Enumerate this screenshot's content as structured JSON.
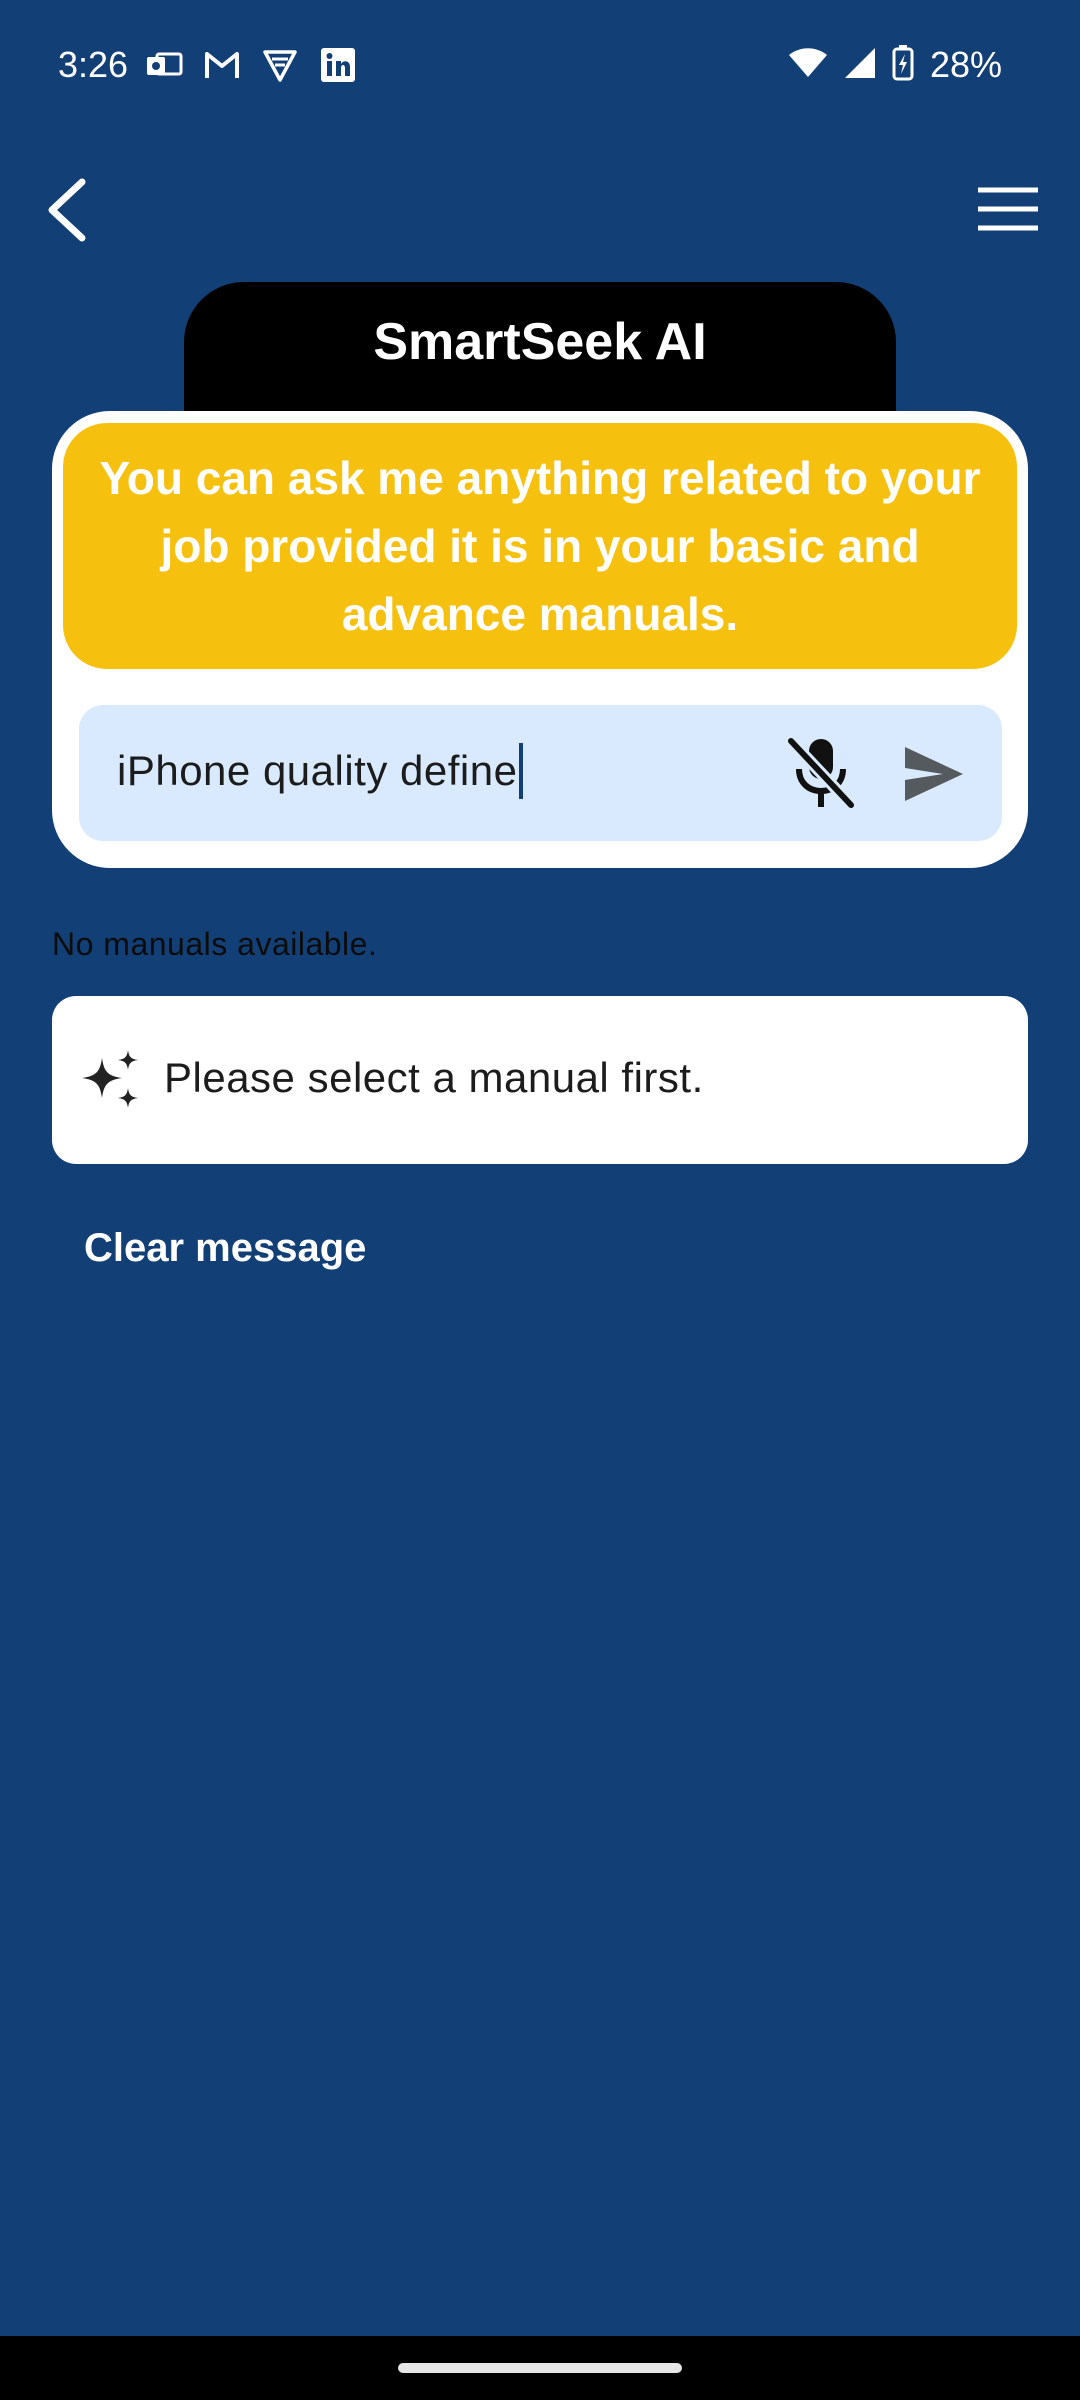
{
  "status_bar": {
    "time": "3:26",
    "battery": "28%",
    "notification_icons": [
      "outlook-icon",
      "gmail-icon",
      "vpn-shield-icon",
      "linkedin-icon"
    ],
    "system_icons": [
      "wifi-icon",
      "signal-icon",
      "battery-charging-icon"
    ]
  },
  "app_bar": {
    "back_icon": "chevron-left-icon",
    "menu_icon": "hamburger-menu-icon"
  },
  "title": "SmartSeek AI",
  "banner": {
    "text": "You can ask me anything related to your job provided it is in your basic and advance manuals.",
    "color": "#f5c10e"
  },
  "query_input": {
    "value": "iPhone quality define",
    "mic_icon": "mic-off-icon",
    "send_icon": "send-icon"
  },
  "manuals_status": "No manuals available.",
  "response": {
    "icon": "sparkle-icon",
    "text": "Please select a manual first."
  },
  "clear_label": "Clear message",
  "colors": {
    "background": "#123f75",
    "input_background": "#d9eafe",
    "title_tab": "#000000"
  }
}
